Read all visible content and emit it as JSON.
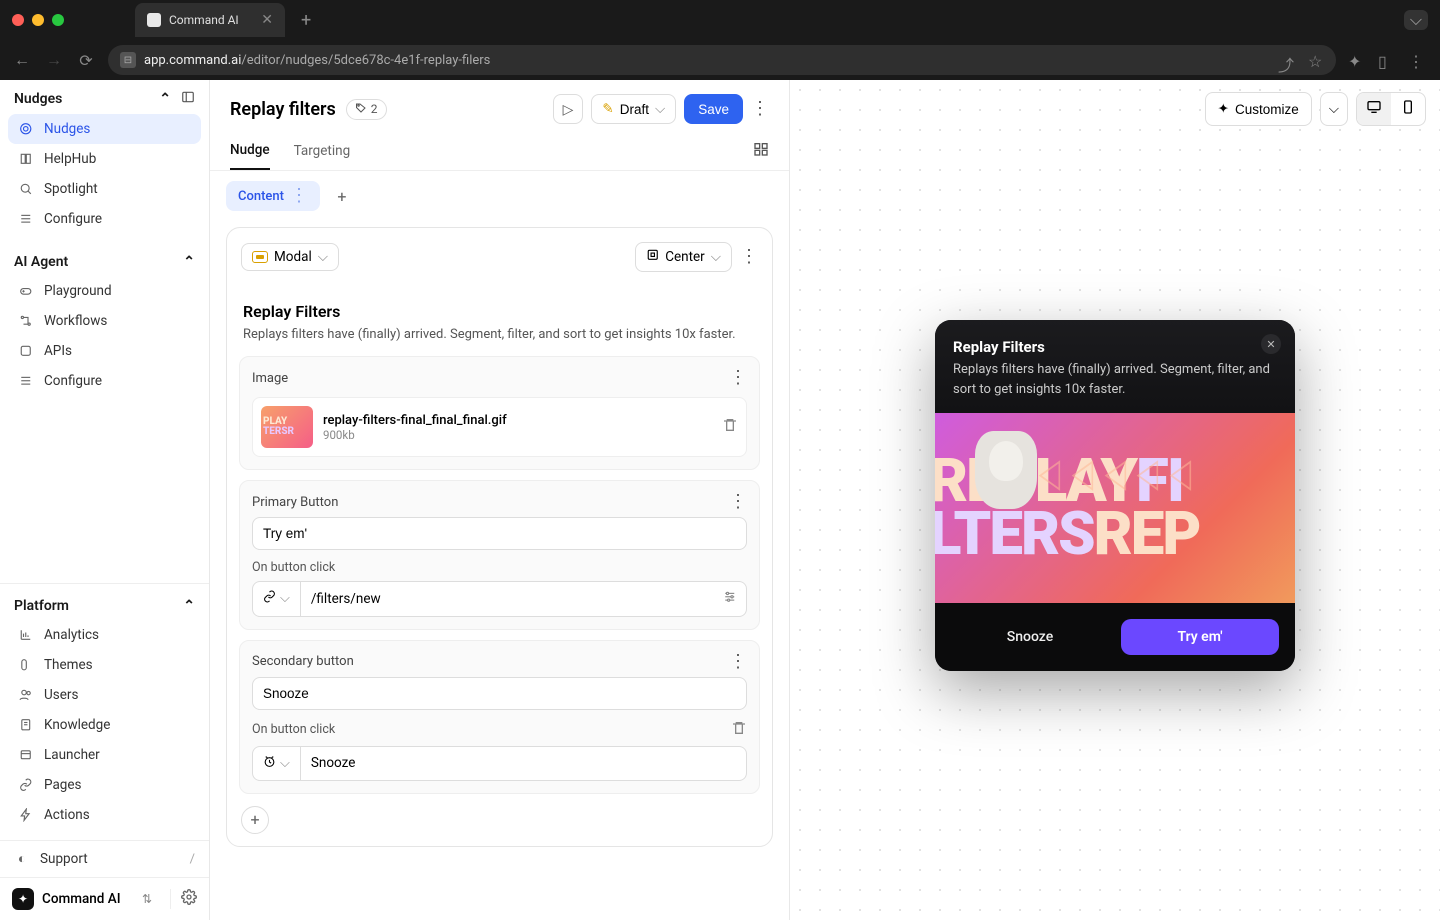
{
  "browser": {
    "tab_title": "Command AI",
    "url_host": "app.command.ai",
    "url_path": "/editor/nudges/5dce678c-4e1f-replay-filers"
  },
  "sidebar": {
    "sections": {
      "nudges": {
        "label": "Nudges",
        "items": [
          {
            "icon": "target",
            "label": "Nudges",
            "active": true
          },
          {
            "icon": "book",
            "label": "HelpHub"
          },
          {
            "icon": "search",
            "label": "Spotlight"
          },
          {
            "icon": "sliders",
            "label": "Configure"
          }
        ]
      },
      "agent": {
        "label": "AI Agent",
        "items": [
          {
            "icon": "gamepad",
            "label": "Playground"
          },
          {
            "icon": "workflow",
            "label": "Workflows"
          },
          {
            "icon": "box",
            "label": "APIs"
          },
          {
            "icon": "sliders",
            "label": "Configure"
          }
        ]
      },
      "platform": {
        "label": "Platform",
        "items": [
          {
            "icon": "chart",
            "label": "Analytics"
          },
          {
            "icon": "swatch",
            "label": "Themes"
          },
          {
            "icon": "users",
            "label": "Users"
          },
          {
            "icon": "docs",
            "label": "Knowledge"
          },
          {
            "icon": "launcher",
            "label": "Launcher"
          },
          {
            "icon": "link",
            "label": "Pages"
          },
          {
            "icon": "bolt",
            "label": "Actions"
          }
        ]
      }
    },
    "support": {
      "label": "Support",
      "shortcut": "/"
    },
    "brand": {
      "name": "Command AI"
    }
  },
  "editor": {
    "title": "Replay filters",
    "tag_count": "2",
    "status_label": "Draft",
    "save_label": "Save",
    "tabs": [
      "Nudge",
      "Targeting"
    ],
    "content_chip": "Content",
    "modal_type": "Modal",
    "position": "Center",
    "heading": "Replay Filters",
    "description": "Replays filters have (finally) arrived. Segment, filter, and sort to get insights 10x faster.",
    "blocks": {
      "image": {
        "label": "Image",
        "file_name": "replay-filters-final_final_final.gif",
        "file_size": "900kb"
      },
      "primary": {
        "label": "Primary Button",
        "value": "Try em'",
        "click_label": "On button click",
        "action_value": "/filters/new"
      },
      "secondary": {
        "label": "Secondary button",
        "value": "Snooze",
        "click_label": "On button click",
        "action_value": "Snooze"
      }
    }
  },
  "preview": {
    "customize_label": "Customize",
    "modal": {
      "title": "Replay Filters",
      "description": "Replays filters have (finally) arrived. Segment, filter, and sort to get insights 10x faster.",
      "secondary_label": "Snooze",
      "primary_label": "Try em'"
    }
  }
}
